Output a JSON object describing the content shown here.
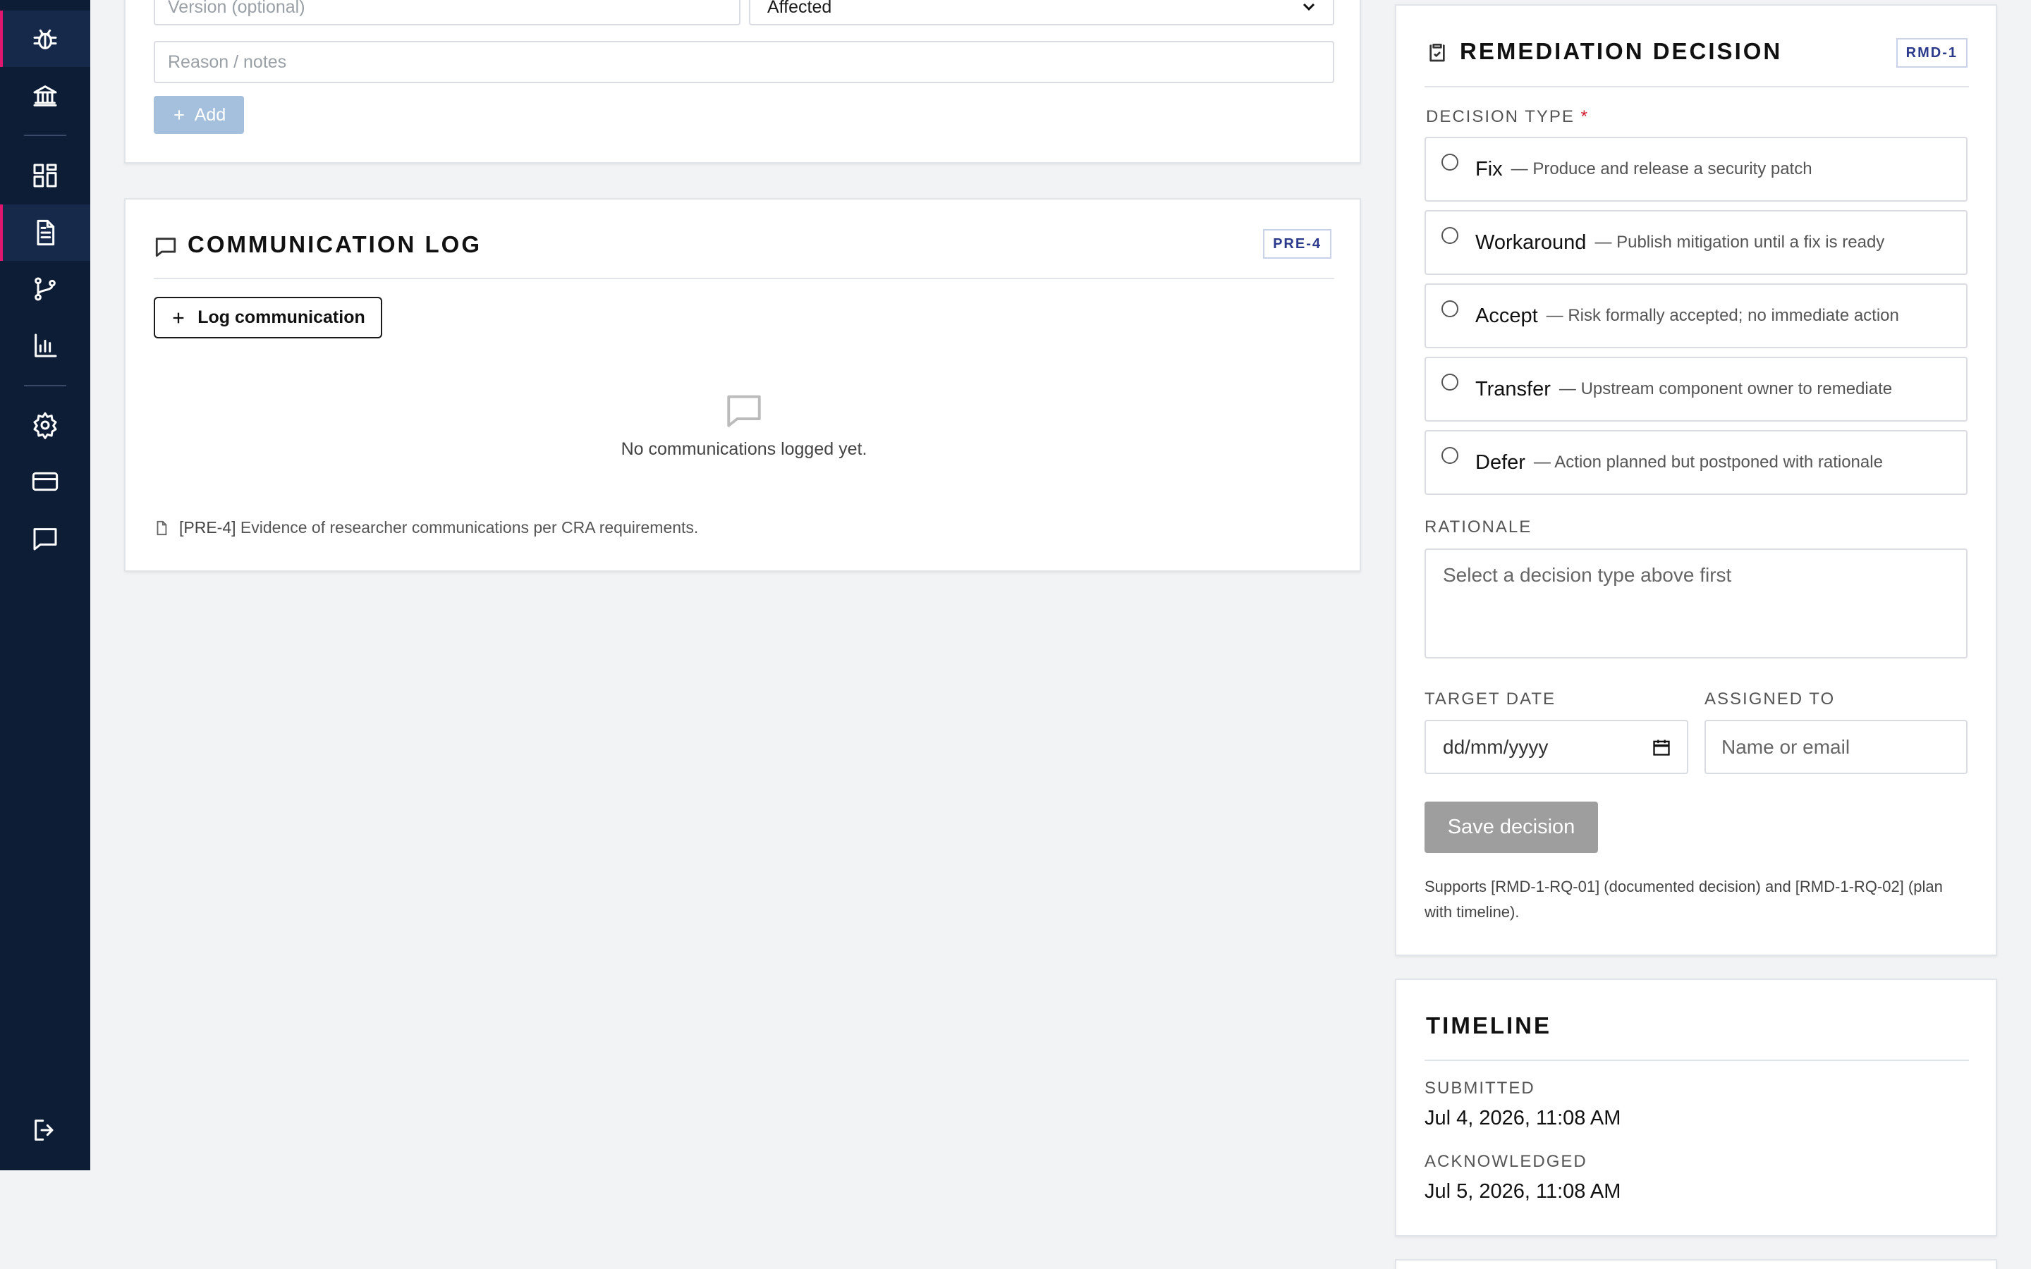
{
  "sidebar": {
    "items": [
      {
        "icon": "bug-icon",
        "active": true
      },
      {
        "icon": "bank-icon"
      },
      {
        "icon": "dashboard-icon"
      },
      {
        "icon": "document-icon",
        "active": true
      },
      {
        "icon": "branch-icon"
      },
      {
        "icon": "chart-icon"
      },
      {
        "icon": "gear-icon"
      },
      {
        "icon": "credit-card-icon"
      },
      {
        "icon": "chat-icon"
      }
    ],
    "logout_icon": "logout-icon"
  },
  "affected_form": {
    "version_placeholder": "Version (optional)",
    "status_value": "Affected",
    "reason_placeholder": "Reason / notes",
    "add_label": "Add"
  },
  "communication_log": {
    "title": "COMMUNICATION LOG",
    "badge": "PRE-4",
    "log_button": "Log communication",
    "empty_text": "No communications logged yet.",
    "footnote_ref": "[PRE-4]",
    "footnote_text": "Evidence of researcher communications per CRA requirements."
  },
  "remediation": {
    "title": "REMEDIATION DECISION",
    "badge": "RMD-1",
    "decision_type_label": "DECISION TYPE",
    "required_mark": "*",
    "options": [
      {
        "label": "Fix",
        "desc": "— Produce and release a security patch"
      },
      {
        "label": "Workaround",
        "desc": "— Publish mitigation until a fix is ready"
      },
      {
        "label": "Accept",
        "desc": "— Risk formally accepted; no immediate action"
      },
      {
        "label": "Transfer",
        "desc": "— Upstream component owner to remediate"
      },
      {
        "label": "Defer",
        "desc": "— Action planned but postponed with rationale"
      }
    ],
    "rationale_label": "RATIONALE",
    "rationale_placeholder": "Select a decision type above first",
    "target_date_label": "TARGET DATE",
    "target_date_placeholder": "dd/mm/yyyy",
    "assigned_to_label": "ASSIGNED TO",
    "assigned_to_placeholder": "Name or email",
    "save_label": "Save decision",
    "support_text": "Supports [RMD-1-RQ-01] (documented decision) and [RMD-1-RQ-02] (plan with timeline)."
  },
  "timeline": {
    "title": "TIMELINE",
    "entries": [
      {
        "label": "SUBMITTED",
        "value": "Jul 4, 2026, 11:08 AM"
      },
      {
        "label": "ACKNOWLEDGED",
        "value": "Jul 5, 2026, 11:08 AM"
      }
    ]
  },
  "colors": {
    "sidebar_bg": "#0d1d36",
    "active_accent": "#e0166f",
    "badge_text": "#2b3a8a",
    "add_button": "#a5c0dc",
    "save_button_disabled": "#9e9e9e",
    "required": "#d01a2b"
  }
}
